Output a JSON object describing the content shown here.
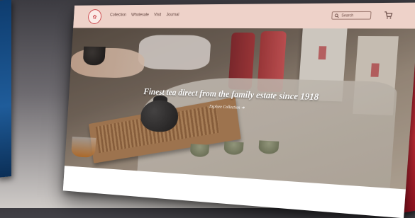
{
  "header": {
    "logo_label": "tea house logo",
    "nav": [
      "Collection",
      "Wholesale",
      "Visit",
      "Journal"
    ],
    "search_placeholder": "Search",
    "cart_label": "cart"
  },
  "hero": {
    "headline": "Finest tea direct from the family estate since 1918",
    "cta_label": "Explore Collection",
    "cta_arrow": "➜"
  },
  "colors": {
    "header_bg": "#eed2c9",
    "brand_red": "#c6393f",
    "hero_text": "#ffffff"
  }
}
